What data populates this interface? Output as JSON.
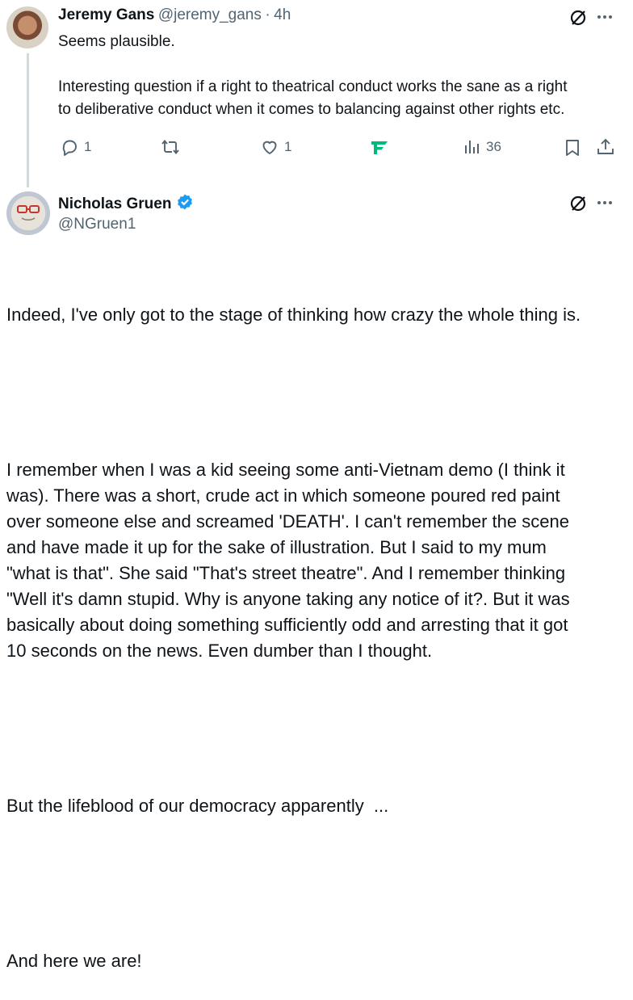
{
  "tweet1": {
    "name": "Jeremy Gans",
    "handle": "@jeremy_gans",
    "separator": "·",
    "time": "4h",
    "text_lines": [
      "Seems plausible.",
      "",
      "Interesting question if a right to theatrical conduct works the sane as a right",
      "to deliberative conduct when it comes to balancing against other rights etc."
    ],
    "replies": "1",
    "likes": "1",
    "views": "36"
  },
  "tweet2": {
    "name": "Nicholas Gruen",
    "handle": "@NGruen1",
    "verified": true,
    "paragraphs": [
      "Indeed, I've only got to the stage of thinking how crazy the whole thing is.",
      "I remember when I was a kid seeing some anti-Vietnam demo (I think it\nwas). There was a short, crude act in which someone poured red paint\nover someone else and screamed 'DEATH'. I can't remember the scene\nand have made it up for the sake of illustration. But I said to my mum\n\"what is that\". She said \"That's street theatre\". And I remember thinking\n\"Well it's damn stupid. Why is anyone taking any notice of it?. But it was\nbasically about doing something sufficiently odd and arresting that it got\n10 seconds on the news. Even dumber than I thought.",
      "But the lifeblood of our democracy apparently  ...",
      "And here we are!"
    ]
  },
  "colors": {
    "text": "#0f1419",
    "secondary": "#536471",
    "verified": "#1d9bf0",
    "brand_teal": "#00ba7c"
  },
  "icons": [
    "grok-slash-icon",
    "more-icon",
    "reply-icon",
    "retweet-icon",
    "like-icon",
    "promote-icon",
    "views-icon",
    "bookmark-icon",
    "share-icon",
    "verified-badge-icon"
  ]
}
